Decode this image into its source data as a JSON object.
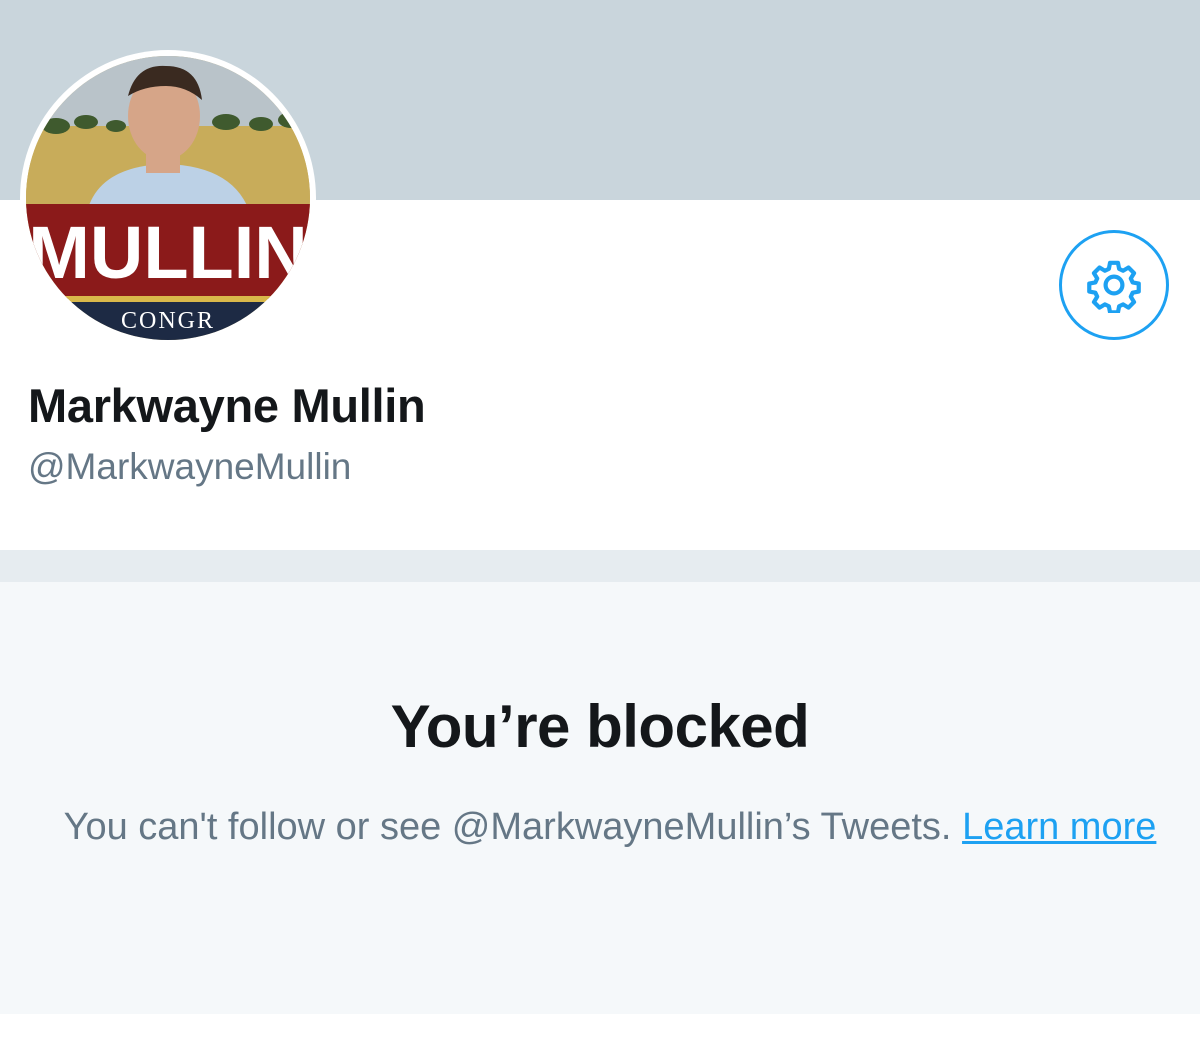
{
  "profile": {
    "display_name": "Markwayne Mullin",
    "handle": "@MarkwayneMullin",
    "avatar_sign_text": "MULLIN",
    "avatar_subtext": "CONGR"
  },
  "header": {
    "settings_icon": "gear-icon"
  },
  "blocked": {
    "title": "You’re blocked",
    "message": "You can't follow or see @MarkwayneMullin’s Tweets.",
    "learn_more_label": "Learn more"
  },
  "colors": {
    "accent": "#1da1f2",
    "banner": "#c9d5dc",
    "panel": "#f5f8fa",
    "secondary_text": "#657786"
  }
}
